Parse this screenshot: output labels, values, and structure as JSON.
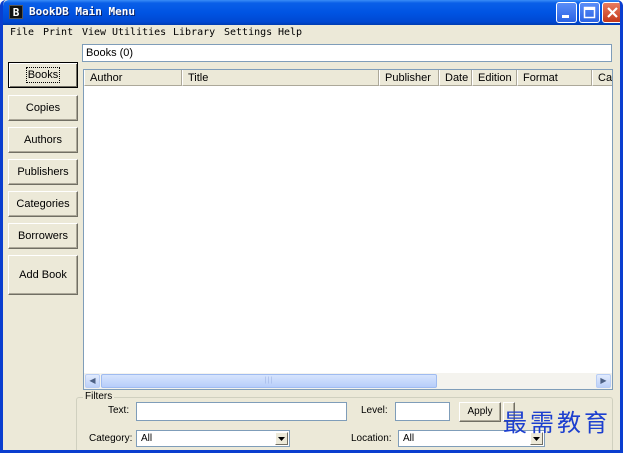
{
  "window": {
    "title": "BookDB Main Menu",
    "icon_letter": "B"
  },
  "menu": [
    "File",
    "Print",
    "View",
    "Utilities",
    "Library",
    "Settings",
    "Help"
  ],
  "header": {
    "text": "Books (0)"
  },
  "nav": {
    "books": "Books",
    "copies": "Copies",
    "authors": "Authors",
    "publishers": "Publishers",
    "categories": "Categories",
    "borrowers": "Borrowers",
    "add_book": "Add Book"
  },
  "grid": {
    "columns": [
      "Author",
      "Title",
      "Publisher",
      "Date",
      "Edition",
      "Format",
      "Call"
    ],
    "rows": []
  },
  "filters": {
    "legend": "Filters",
    "text_label": "Text:",
    "text_value": "",
    "level_label": "Level:",
    "level_value": "",
    "apply_label": "Apply",
    "category_label": "Category:",
    "category_value": "All",
    "location_label": "Location:",
    "location_value": "All"
  },
  "watermark": "最需教育",
  "colors": {
    "titlebar": "#0054e3",
    "face": "#ece9d8",
    "watermark": "#1c3fcf"
  }
}
